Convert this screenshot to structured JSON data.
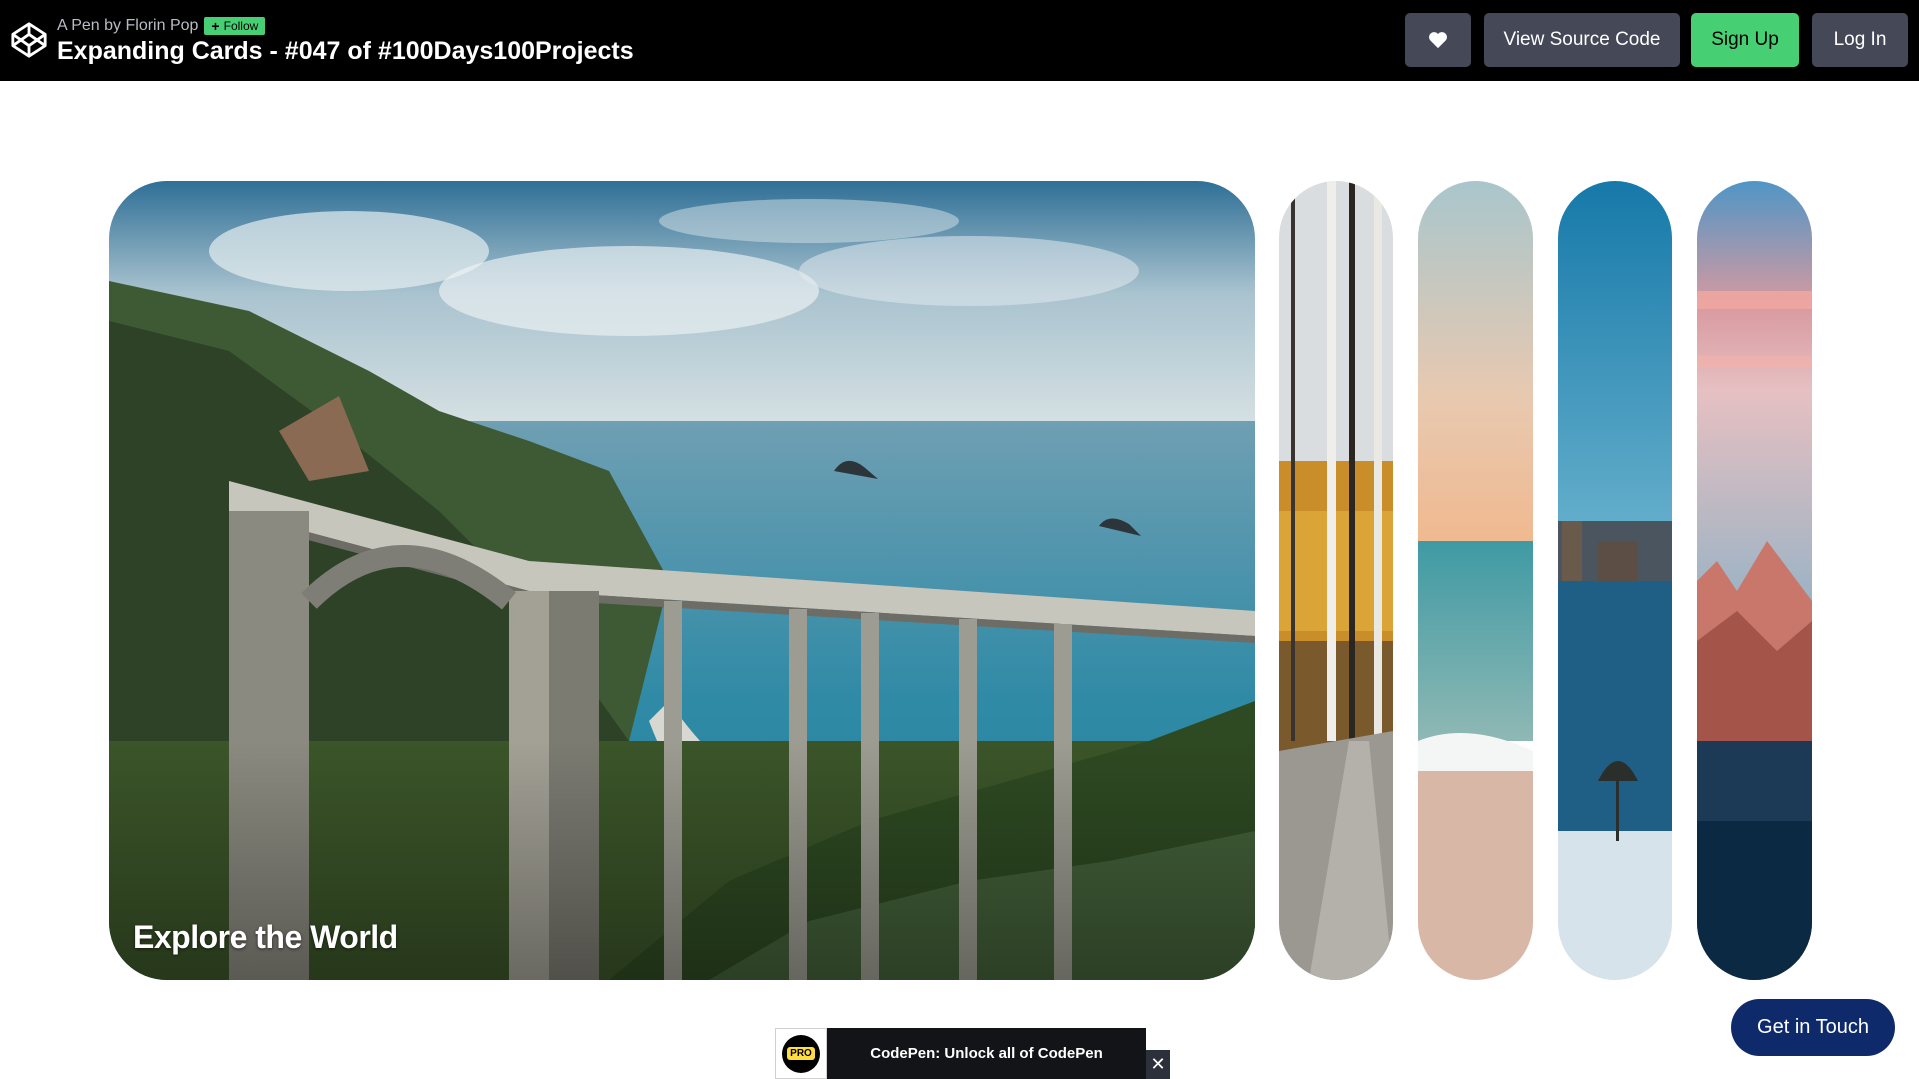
{
  "header": {
    "byline": "A Pen by Florin Pop",
    "follow_label": "Follow",
    "title": "Expanding Cards - #047 of #100Days100Projects",
    "buttons": {
      "view_source": "View Source Code",
      "sign_up": "Sign Up",
      "log_in": "Log In"
    }
  },
  "cards": {
    "active_title": "Explore the World",
    "items": [
      "bridge",
      "forest",
      "beach",
      "city",
      "mountains"
    ]
  },
  "promo": {
    "badge": "PRO",
    "text": "CodePen: Unlock all of CodePen",
    "close": "✕"
  },
  "contact": {
    "label": "Get in Touch"
  },
  "colors": {
    "topbar": "#000000",
    "button": "#444857",
    "signup": "#47cf73",
    "contact": "#0f2a6b"
  }
}
